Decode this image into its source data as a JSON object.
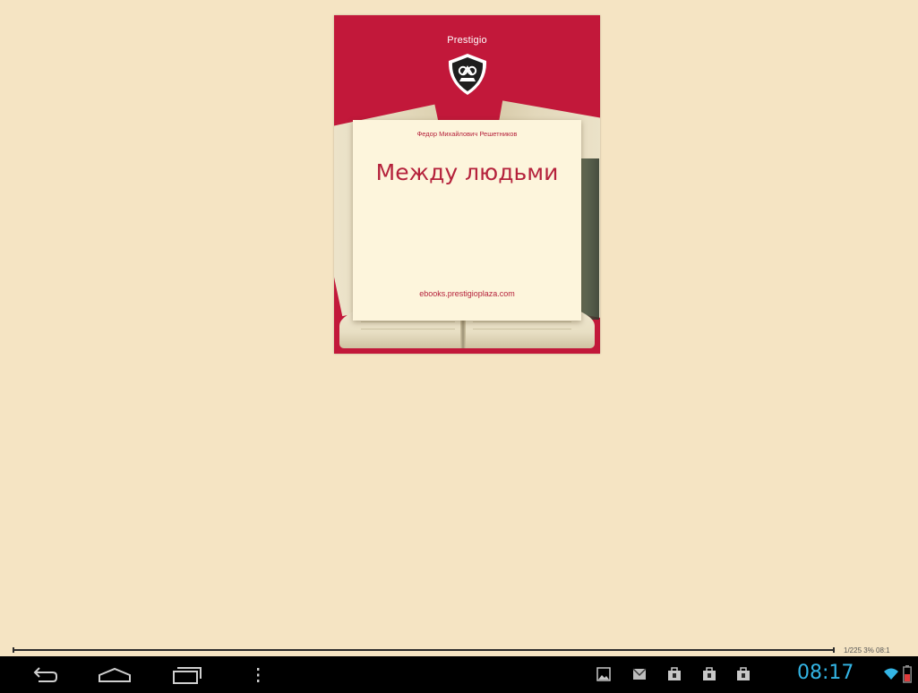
{
  "book": {
    "publisher": "Prestigio",
    "author": "Федор Михайлович Решетников",
    "title": "Между людьми",
    "site": "ebooks.prestigioplaza.com"
  },
  "reader": {
    "page_info": "1/225 3% 08:1",
    "progress_fraction": 0.03
  },
  "system_bar": {
    "clock": "08:17",
    "nav_icons": [
      "back-icon",
      "home-icon",
      "recent-apps-icon",
      "menu-icon"
    ],
    "status_icons": [
      "gallery-notification-icon",
      "mail-notification-icon",
      "download-notification-icon",
      "download-notification-icon",
      "download-notification-icon",
      "wifi-icon",
      "battery-icon"
    ],
    "accent": "#33b5e5",
    "battery_color": "#e03b3b"
  },
  "colors": {
    "page_background": "#f5e4c3",
    "cover_red": "#c2183a",
    "cover_text": "#b5223c"
  }
}
